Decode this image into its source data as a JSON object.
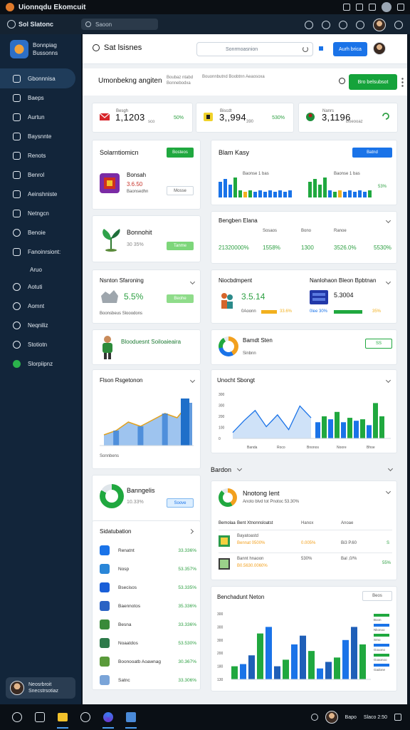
{
  "statusbar": {
    "title": "Uionnqdu Ekomcuit"
  },
  "topstrip": {
    "brand": "Sol Slatonc",
    "search_placeholder": "Saoon"
  },
  "sidebar": {
    "logo_line1": "Bonnpiag",
    "logo_line2": "Bussonns",
    "items": [
      {
        "label": "Gbonnnisa",
        "icon": "file-icon",
        "active": true
      },
      {
        "label": "Baeps",
        "icon": "card-icon"
      },
      {
        "label": "Aurtun",
        "icon": "home-icon"
      },
      {
        "label": "Baysnnte",
        "icon": "star-icon"
      },
      {
        "label": "Renots",
        "icon": "document-icon"
      },
      {
        "label": "Benrol",
        "icon": "folder-icon"
      },
      {
        "label": "Aeinshniste",
        "icon": "building-icon"
      },
      {
        "label": "Netngcn",
        "icon": "grid-icon"
      },
      {
        "label": "Benoie",
        "icon": "chat-icon"
      },
      {
        "label": "Fanoinrsiont:",
        "icon": "send-icon"
      },
      {
        "label": "Aruo",
        "icon": "",
        "sub": true
      },
      {
        "label": "Aotuti",
        "icon": "person-icon"
      },
      {
        "label": "Aomnt",
        "icon": "search-icon"
      },
      {
        "label": "Neqniliz",
        "icon": "settings-icon"
      },
      {
        "label": "Stotiotn",
        "icon": "globe-icon"
      },
      {
        "label": "Slorpiipnz",
        "icon": "check-icon"
      }
    ],
    "profile_line1": "Neosrbroit",
    "profile_line2": "Snecstrsotiaz"
  },
  "header": {
    "title": "Sat lsisnes",
    "input_value": "Sonrmoasnion",
    "button_label": "Aurh brica"
  },
  "subheader": {
    "title": "Umonbekng angiten",
    "meta1": "Boubaz ntabd Bonnebodxa",
    "meta2": "Bouonnbutnd Boobtnn Aeaosoxa",
    "button_label": "Bro belsubsot"
  },
  "kpis": [
    {
      "value": "1,1203",
      "meta": "sco",
      "pct": "50%",
      "sub": "Besgh"
    },
    {
      "value": "3,,994",
      "meta": "390",
      "pct": "530%",
      "sub": "Biscdt"
    },
    {
      "value": "3,1196",
      "meta": "Boeooaz",
      "pct": "",
      "sub": "Nanrs"
    }
  ],
  "card_solar": {
    "title": "Solarntiomicn",
    "badge": "Bosteos",
    "item_title": "Bonsah",
    "item_value": "3.6.50",
    "item_meta": "Baonsedhn",
    "button": "Mosse"
  },
  "card_bonnohi": {
    "title": "Bonnohit",
    "value": "30 35%",
    "button": "Tanme"
  },
  "card_storing": {
    "title": "Nsnton Sfaroning",
    "value": "5.5%",
    "meta": "Boonsbeus Slooodons",
    "button": "Beohe"
  },
  "card_hero": {
    "title": "Blooduesnt Soiloaieaira"
  },
  "card_flown": {
    "title": "Flson Rsgetonon",
    "footer": "Sonnbens"
  },
  "card_donut1": {
    "title": "Banngelis",
    "value": "10.33%",
    "button": "Soove"
  },
  "list": {
    "title": "Sidatubation",
    "rows": [
      {
        "label": "Renatnt",
        "value": "33.336%"
      },
      {
        "label": "Nosp",
        "value": "53.357%"
      },
      {
        "label": "Bsecisos",
        "value": "53.335%"
      },
      {
        "label": "Baennotos",
        "value": "35.336%"
      },
      {
        "label": "Besna",
        "value": "33.336%"
      },
      {
        "label": "Noaatdos",
        "value": "53.530%"
      },
      {
        "label": "Boonooatb Aoawnag",
        "value": "30.367%"
      },
      {
        "label": "Satnc",
        "value": "33.306%"
      }
    ]
  },
  "card_bar_mix": {
    "title": "Blam Kasy",
    "button": "Batnd",
    "left_label": "Baonse 1 bas",
    "right_label": "Baonse 1 bas",
    "pct": "53%"
  },
  "card_table": {
    "title": "Bengben Elana",
    "headers": [
      "Sosaos",
      "Bono",
      "Ranoe"
    ],
    "values": [
      "21320000%",
      "1558%",
      "1300",
      "3526.0%",
      "5530%"
    ]
  },
  "card_income": {
    "title": "Niocbdmpent",
    "value": "3.5.14",
    "value_meta": "0Aoonn",
    "pct": "33.6%"
  },
  "card_newheat": {
    "title": "Nanlohaon Bleon Bpbtnan",
    "value": "5.3004",
    "meta": "0lee 30%",
    "pct": "35%"
  },
  "card_plan": {
    "title": "Bamdt Sten",
    "meta": "Sinbnn",
    "button": "SS"
  },
  "card_unoch": {
    "title": "Unocht Sbongt",
    "y_ticks": [
      "300",
      "300",
      "200",
      "100",
      "0"
    ],
    "x_ticks": [
      "Banda",
      "Roco",
      "Bnonos",
      "Noore",
      "Bhoe"
    ]
  },
  "section_bardon": {
    "title": "Bardon"
  },
  "card_nontong": {
    "title": "Nnotong Ient",
    "meta": "Anoto blvd tot Pnotoc    53.30%",
    "headers": [
      "Bemolaa",
      "Bent Xtnonnsloatst",
      "Hanox",
      "Anoae"
    ],
    "rows": [
      {
        "label": "Bayatoastd",
        "values": [
          "0.005%",
          "Bolosmte 31.00%",
          "Bi3 P.60",
          "S"
        ],
        "name": "Bennat 0500%"
      },
      {
        "label": "Bannt hnaoon",
        "values": [
          "530%",
          "Bal ,0/%"
        ],
        "name": "B0.5630.0060%",
        "pct": "55%"
      }
    ]
  },
  "card_renchedu": {
    "title": "Benchadunt Neton",
    "button": "Beos",
    "y_ticks": [
      "300",
      "300",
      "300",
      "200",
      "180",
      "130"
    ],
    "legend": [
      "Boon",
      "Nkonoo",
      "Srno",
      "Gouono",
      "Goaonoo",
      "Gadone"
    ]
  },
  "taskbar": {
    "clock_line1": "Bapo",
    "clock_line2": "Slaco 2:50"
  },
  "colors": {
    "accent_blue": "#1a73e8",
    "accent_green": "#20a83f",
    "sidebar": "#12253a"
  },
  "chart_data": [
    {
      "type": "area",
      "title": "Flson Rsgetonon",
      "series": [
        {
          "name": "",
          "values": [
            10,
            14,
            22,
            18,
            24,
            30,
            26,
            40
          ]
        }
      ]
    },
    {
      "type": "line",
      "title": "Unocht Sbongt",
      "x": [
        "Banda",
        "Roco",
        "Bnonos",
        "Noore",
        "Bhoe"
      ],
      "ylim": [
        0,
        300
      ],
      "series": [
        {
          "name": "",
          "values": [
            40,
            120,
            190,
            80,
            160,
            60,
            220,
            140
          ]
        }
      ]
    },
    {
      "type": "bar",
      "title": "Benchadunt Neton",
      "ylim": [
        0,
        300
      ],
      "series": [
        {
          "name": "",
          "values": [
            60,
            70,
            110,
            210,
            240,
            60,
            90,
            160,
            200,
            130,
            50,
            80,
            100,
            180,
            240,
            160
          ]
        }
      ]
    }
  ]
}
